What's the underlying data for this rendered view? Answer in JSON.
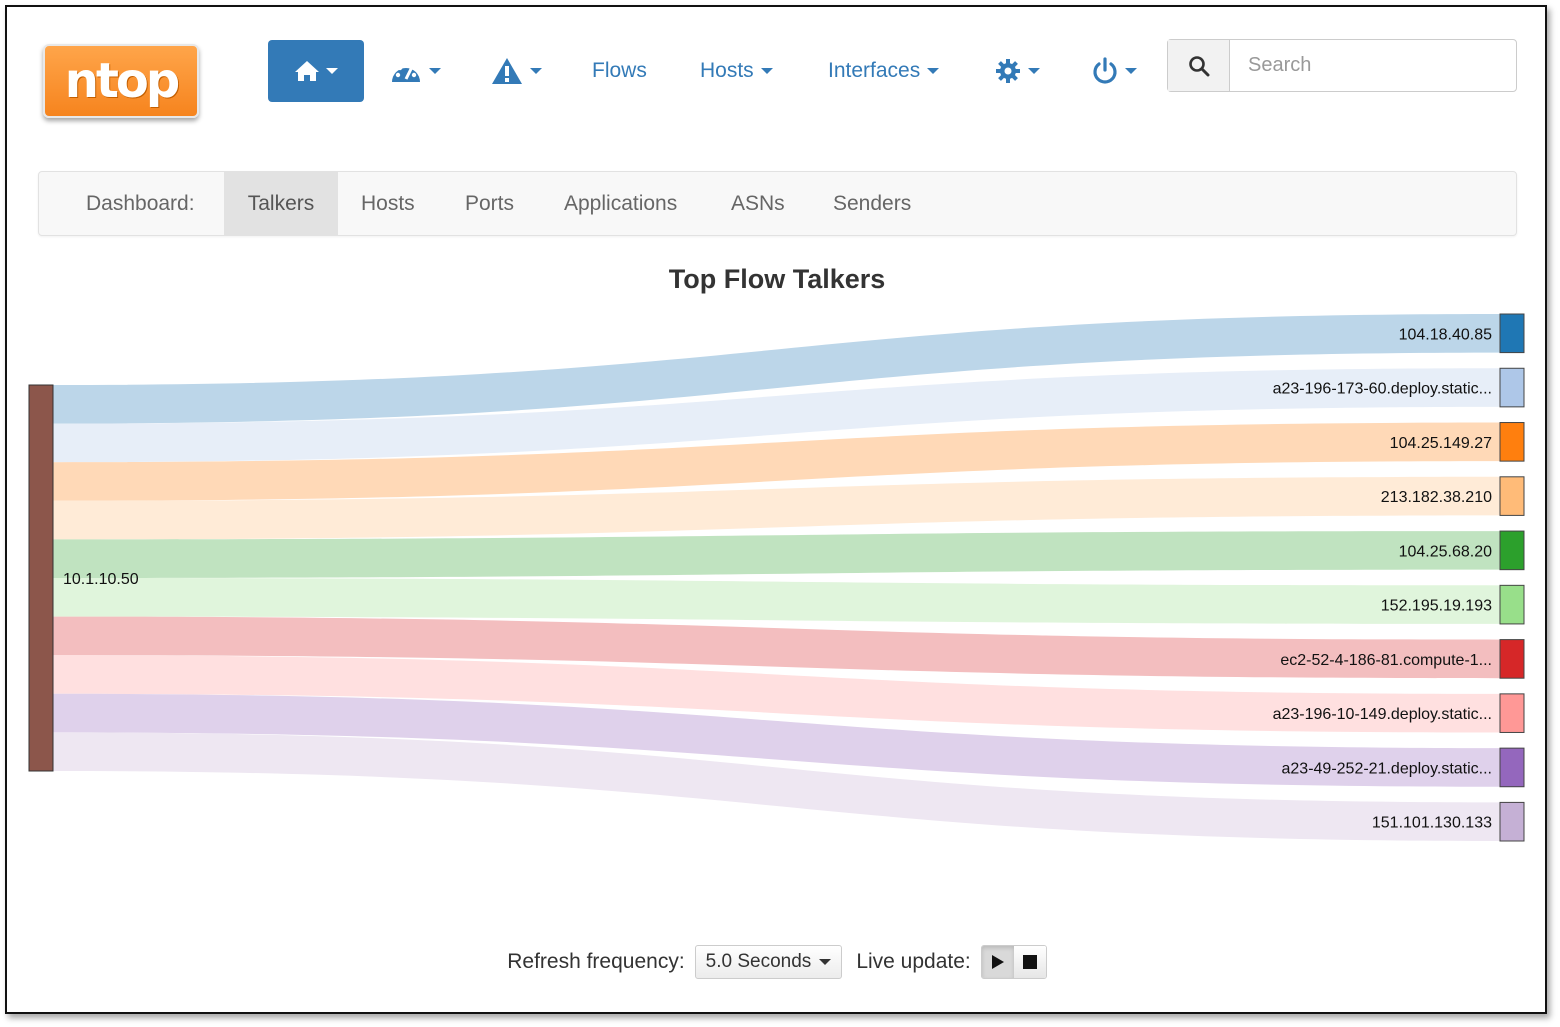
{
  "logo": {
    "text": "ntop"
  },
  "navbar": {
    "home_icon": "home-icon",
    "dashboard_icon": "dashboard-gauge-icon",
    "alerts_icon": "warning-triangle-icon",
    "flows_label": "Flows",
    "hosts_label": "Hosts",
    "interfaces_label": "Interfaces",
    "settings_icon": "gear-icon",
    "power_icon": "power-icon",
    "search_placeholder": "Search",
    "accent_color": "#337ab7"
  },
  "dashboard_tabs": {
    "label": "Dashboard:",
    "tabs": [
      "Talkers",
      "Hosts",
      "Ports",
      "Applications",
      "ASNs",
      "Senders"
    ],
    "active": "Talkers"
  },
  "chart_data": {
    "type": "sankey",
    "title": "Top Flow Talkers",
    "source": {
      "name": "10.1.10.50",
      "color": "#8c564b"
    },
    "targets": [
      {
        "name": "104.18.40.85",
        "color": "#1f77b4",
        "value": 1
      },
      {
        "name": "a23-196-173-60.deploy.static...",
        "color": "#aec7e8",
        "value": 1
      },
      {
        "name": "104.25.149.27",
        "color": "#ff7f0e",
        "value": 1
      },
      {
        "name": "213.182.38.210",
        "color": "#ffbb78",
        "value": 1
      },
      {
        "name": "104.25.68.20",
        "color": "#2ca02c",
        "value": 1
      },
      {
        "name": "152.195.19.193",
        "color": "#98df8a",
        "value": 1
      },
      {
        "name": "ec2-52-4-186-81.compute-1...",
        "color": "#d62728",
        "value": 1
      },
      {
        "name": "a23-196-10-149.deploy.static...",
        "color": "#ff9896",
        "value": 1
      },
      {
        "name": "a23-49-252-21.deploy.static...",
        "color": "#9467bd",
        "value": 1
      },
      {
        "name": "151.101.130.133",
        "color": "#c5b0d5",
        "value": 1
      }
    ]
  },
  "footer": {
    "refresh_label": "Refresh frequency:",
    "refresh_value": "5.0 Seconds",
    "live_label": "Live update:",
    "play_icon": "play-icon",
    "stop_icon": "stop-icon"
  }
}
